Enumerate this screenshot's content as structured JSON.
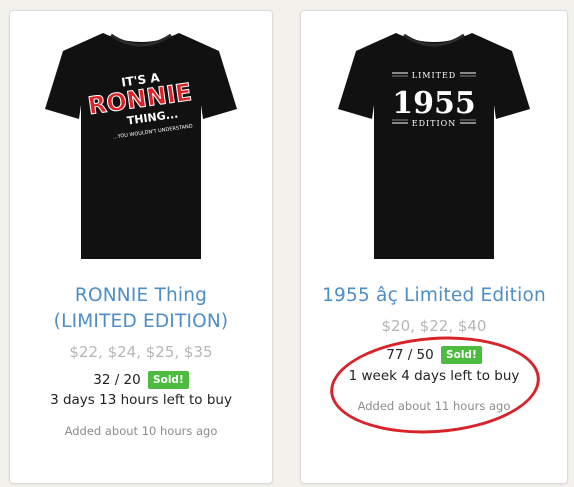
{
  "products": [
    {
      "title_line1": "RONNIE Thing",
      "title_line2": "(LIMITED EDITION)",
      "price": "$22, $24, $25, $35",
      "sold_count": "32 / 20",
      "sold_label": "Sold!",
      "time_left": "3 days 13 hours left to buy",
      "added": "Added about 10 hours ago",
      "shirt_print": {
        "line1": "IT'S A",
        "line2": "RONNIE",
        "line3": "THING...",
        "tagline": "...YOU WOULDN'T UNDERSTAND"
      }
    },
    {
      "title_line1": "1955 âç Limited Edition",
      "price": "$20, $22, $40",
      "sold_count": "77 / 50",
      "sold_label": "Sold!",
      "time_left": "1 week 4 days left to buy",
      "added": "Added about 11 hours ago",
      "shirt_print": {
        "top": "LIMITED",
        "year": "1955",
        "bottom": "EDITION"
      }
    }
  ],
  "colors": {
    "title": "#4d8ec7",
    "price": "#b6b6b6",
    "sold_badge": "#4dbb3f",
    "annotation": "#d8232a",
    "shirt": "#111111"
  }
}
